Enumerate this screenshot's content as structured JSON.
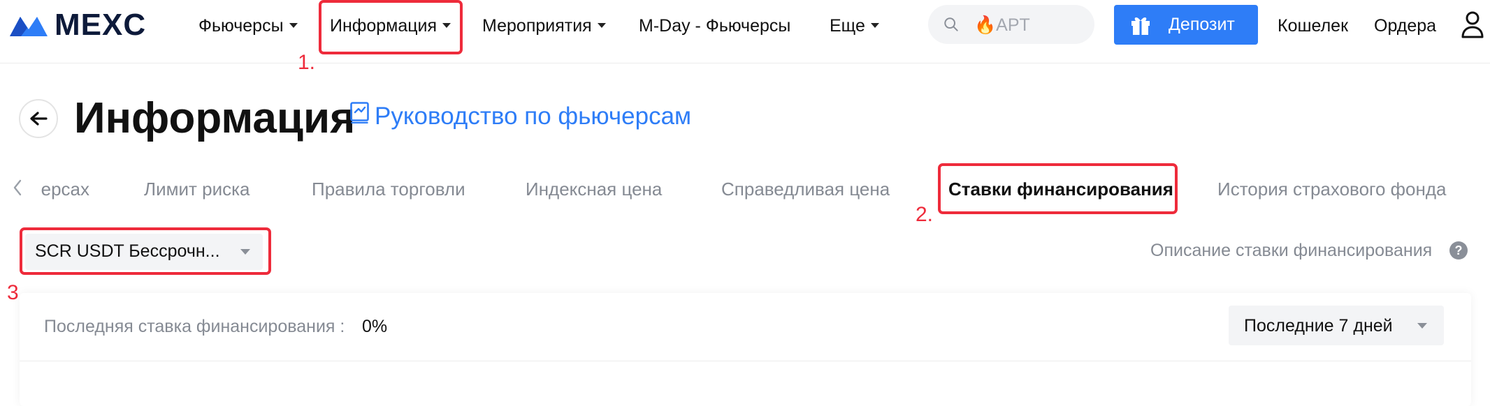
{
  "header": {
    "logo_text": "MEXC",
    "nav": [
      {
        "label": "Фьючерсы",
        "has_dropdown": true
      },
      {
        "label": "Информация",
        "has_dropdown": true
      },
      {
        "label": "Мероприятия",
        "has_dropdown": true
      },
      {
        "label": "M-Day - Фьючерсы",
        "has_dropdown": false
      },
      {
        "label": "Еще",
        "has_dropdown": true
      }
    ],
    "search": {
      "placeholder_prefix": "🔥",
      "placeholder_text": "APT",
      "icon": "search-icon"
    },
    "deposit_label": "Депозит",
    "wallet_label": "Кошелек",
    "orders_label": "Ордера",
    "user_icon": "user-icon"
  },
  "annotations": [
    "1.",
    "2.",
    "3."
  ],
  "page": {
    "title": "Информация",
    "guide_link": "Руководство по фьючерсам"
  },
  "tabs": {
    "items": [
      {
        "label": "ерсах",
        "active": false
      },
      {
        "label": "Лимит риска",
        "active": false
      },
      {
        "label": "Правила торговли",
        "active": false
      },
      {
        "label": "Индексная цена",
        "active": false
      },
      {
        "label": "Справедливая цена",
        "active": false
      },
      {
        "label": "Ставки финансирования",
        "active": true
      },
      {
        "label": "История страхового фонда",
        "active": false
      }
    ]
  },
  "controls": {
    "contract_select": "SCR USDT Бессрочн...",
    "funding_description": "Описание ставки финансирования",
    "help_icon": "?"
  },
  "card": {
    "last_rate_label": "Последняя ставка финансирования :",
    "last_rate_value": "0%",
    "period_select": "Последние 7 дней"
  },
  "colors": {
    "accent": "#2e7df7",
    "annotation_red": "#ee2b3b",
    "muted_text": "#858a93",
    "logo_blue": "#2e7df7",
    "logo_navy": "#0d1a3a"
  }
}
